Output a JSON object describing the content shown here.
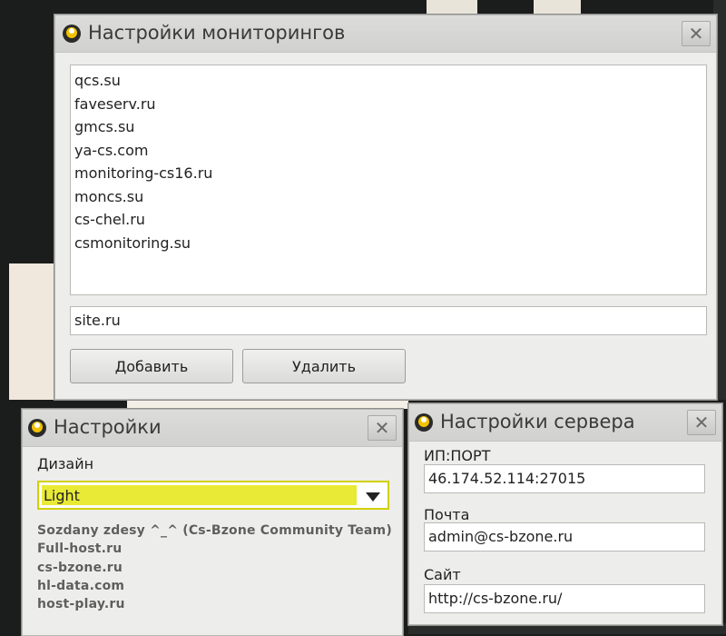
{
  "monitoring_window": {
    "title": "Настройки мониторингов",
    "close_label": "✕",
    "sites": [
      "qcs.su",
      "faveserv.ru",
      "gmcs.su",
      "ya-cs.com",
      "monitoring-cs16.ru",
      "moncs.su",
      "cs-chel.ru",
      "csmonitoring.su"
    ],
    "new_site_value": "site.ru",
    "add_button": "Добавить",
    "delete_button": "Удалить"
  },
  "settings_window": {
    "title": "Настройки",
    "close_label": "✕",
    "design_label": "Дизайн",
    "design_selected": "Light",
    "credits": [
      "Sozdany zdesy ^_^ (Cs-Bzone Community Team)",
      "Full-host.ru",
      "cs-bzone.ru",
      "hl-data.com",
      "host-play.ru"
    ]
  },
  "server_window": {
    "title": "Настройки сервера",
    "close_label": "✕",
    "ip_label": "ИП:ПОРТ",
    "ip_value": "46.174.52.114:27015",
    "mail_label": "Почта",
    "mail_value": "admin@cs-bzone.ru",
    "site_label": "Сайт",
    "site_value": "http://cs-bzone.ru/"
  },
  "colors": {
    "window_bg": "#ededeb",
    "dropdown_highlight": "#e9ea36"
  }
}
